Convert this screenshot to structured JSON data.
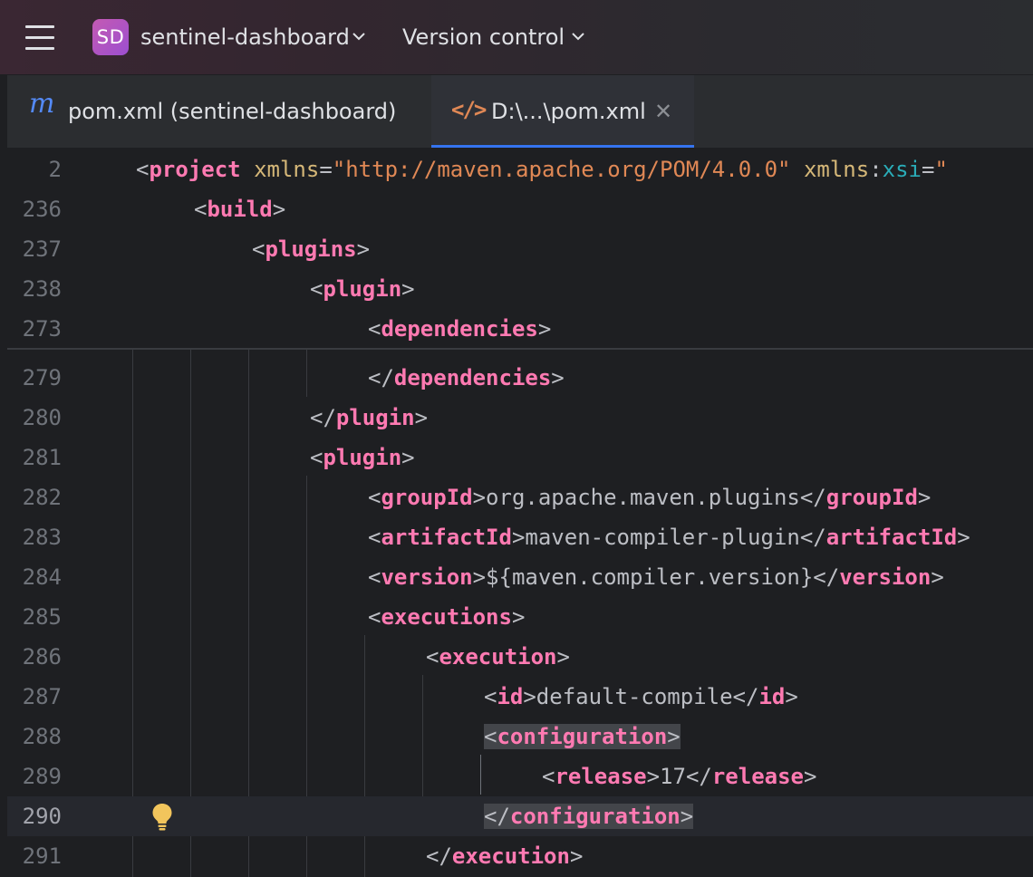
{
  "titlebar": {
    "project_badge": "SD",
    "project_name": "sentinel-dashboard",
    "vcs_label": "Version control"
  },
  "tabs": [
    {
      "label": "pom.xml (sentinel-dashboard)",
      "icon": "maven-icon",
      "active": false
    },
    {
      "label": "D:\\...\\pom.xml",
      "icon": "xml-file-icon",
      "active": true
    }
  ],
  "editor": {
    "sticky_lines": [
      {
        "n": "2",
        "code": "<project xmlns=\"http://maven.apache.org/POM/4.0.0\" xmlns:xsi=\""
      },
      {
        "n": "236",
        "code": "<build>"
      },
      {
        "n": "237",
        "code": "<plugins>"
      },
      {
        "n": "238",
        "code": "<plugin>"
      },
      {
        "n": "273",
        "code": "<dependencies>"
      }
    ],
    "lines": [
      {
        "n": "279",
        "code": "</dependencies>"
      },
      {
        "n": "280",
        "code": "</plugin>"
      },
      {
        "n": "281",
        "code": "<plugin>"
      },
      {
        "n": "282",
        "code": "<groupId>org.apache.maven.plugins</groupId>"
      },
      {
        "n": "283",
        "code": "<artifactId>maven-compiler-plugin</artifactId>"
      },
      {
        "n": "284",
        "code": "<version>${maven.compiler.version}</version>"
      },
      {
        "n": "285",
        "code": "<executions>"
      },
      {
        "n": "286",
        "code": "<execution>"
      },
      {
        "n": "287",
        "code": "<id>default-compile</id>"
      },
      {
        "n": "288",
        "code": "<configuration>"
      },
      {
        "n": "289",
        "code": "<release>17</release>"
      },
      {
        "n": "290",
        "code": "</configuration>"
      },
      {
        "n": "291",
        "code": "</execution>"
      }
    ],
    "current_line": "290",
    "intention_icon": "lightbulb-icon"
  },
  "colors": {
    "accent": "#3574f0",
    "tag": "#ff7ab2",
    "attribute": "#d5b778",
    "string": "#e08855",
    "namespace": "#2aacb8",
    "text": "#bcbec4",
    "background": "#1e1f22"
  }
}
